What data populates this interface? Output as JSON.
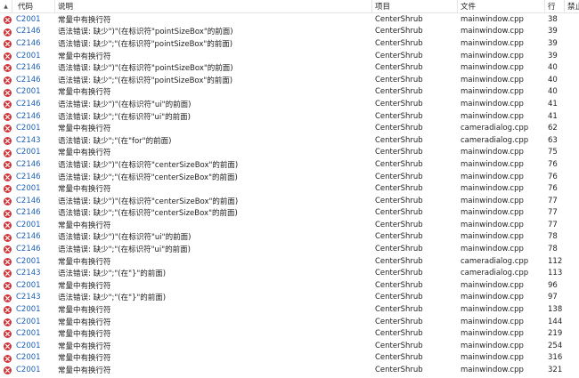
{
  "headers": {
    "code": "代码",
    "description": "说明",
    "project": "项目",
    "file": "文件",
    "line": "行",
    "suppression": "禁止"
  },
  "rows": [
    {
      "code": "C2001",
      "description": "常量中有换行符",
      "project": "CenterShrub",
      "file": "mainwindow.cpp",
      "line": "38"
    },
    {
      "code": "C2146",
      "description": "语法错误: 缺少\")\"(在标识符\"pointSizeBox\"的前面)",
      "project": "CenterShrub",
      "file": "mainwindow.cpp",
      "line": "39"
    },
    {
      "code": "C2146",
      "description": "语法错误: 缺少\";\"(在标识符\"pointSizeBox\"的前面)",
      "project": "CenterShrub",
      "file": "mainwindow.cpp",
      "line": "39"
    },
    {
      "code": "C2001",
      "description": "常量中有换行符",
      "project": "CenterShrub",
      "file": "mainwindow.cpp",
      "line": "39"
    },
    {
      "code": "C2146",
      "description": "语法错误: 缺少\")\"(在标识符\"pointSizeBox\"的前面)",
      "project": "CenterShrub",
      "file": "mainwindow.cpp",
      "line": "40"
    },
    {
      "code": "C2146",
      "description": "语法错误: 缺少\";\"(在标识符\"pointSizeBox\"的前面)",
      "project": "CenterShrub",
      "file": "mainwindow.cpp",
      "line": "40"
    },
    {
      "code": "C2001",
      "description": "常量中有换行符",
      "project": "CenterShrub",
      "file": "mainwindow.cpp",
      "line": "40"
    },
    {
      "code": "C2146",
      "description": "语法错误: 缺少\")\"(在标识符\"ui\"的前面)",
      "project": "CenterShrub",
      "file": "mainwindow.cpp",
      "line": "41"
    },
    {
      "code": "C2146",
      "description": "语法错误: 缺少\";\"(在标识符\"ui\"的前面)",
      "project": "CenterShrub",
      "file": "mainwindow.cpp",
      "line": "41"
    },
    {
      "code": "C2001",
      "description": "常量中有换行符",
      "project": "CenterShrub",
      "file": "cameradialog.cpp",
      "line": "62"
    },
    {
      "code": "C2143",
      "description": "语法错误: 缺少\";\"(在\"for\"的前面)",
      "project": "CenterShrub",
      "file": "cameradialog.cpp",
      "line": "63"
    },
    {
      "code": "C2001",
      "description": "常量中有换行符",
      "project": "CenterShrub",
      "file": "mainwindow.cpp",
      "line": "75"
    },
    {
      "code": "C2146",
      "description": "语法错误: 缺少\")\"(在标识符\"centerSizeBox\"的前面)",
      "project": "CenterShrub",
      "file": "mainwindow.cpp",
      "line": "76"
    },
    {
      "code": "C2146",
      "description": "语法错误: 缺少\";\"(在标识符\"centerSizeBox\"的前面)",
      "project": "CenterShrub",
      "file": "mainwindow.cpp",
      "line": "76"
    },
    {
      "code": "C2001",
      "description": "常量中有换行符",
      "project": "CenterShrub",
      "file": "mainwindow.cpp",
      "line": "76"
    },
    {
      "code": "C2146",
      "description": "语法错误: 缺少\")\"(在标识符\"centerSizeBox\"的前面)",
      "project": "CenterShrub",
      "file": "mainwindow.cpp",
      "line": "77"
    },
    {
      "code": "C2146",
      "description": "语法错误: 缺少\";\"(在标识符\"centerSizeBox\"的前面)",
      "project": "CenterShrub",
      "file": "mainwindow.cpp",
      "line": "77"
    },
    {
      "code": "C2001",
      "description": "常量中有换行符",
      "project": "CenterShrub",
      "file": "mainwindow.cpp",
      "line": "77"
    },
    {
      "code": "C2146",
      "description": "语法错误: 缺少\")\"(在标识符\"ui\"的前面)",
      "project": "CenterShrub",
      "file": "mainwindow.cpp",
      "line": "78"
    },
    {
      "code": "C2146",
      "description": "语法错误: 缺少\";\"(在标识符\"ui\"的前面)",
      "project": "CenterShrub",
      "file": "mainwindow.cpp",
      "line": "78"
    },
    {
      "code": "C2001",
      "description": "常量中有换行符",
      "project": "CenterShrub",
      "file": "cameradialog.cpp",
      "line": "112"
    },
    {
      "code": "C2143",
      "description": "语法错误: 缺少\";\"(在\"}\"的前面)",
      "project": "CenterShrub",
      "file": "cameradialog.cpp",
      "line": "113"
    },
    {
      "code": "C2001",
      "description": "常量中有换行符",
      "project": "CenterShrub",
      "file": "mainwindow.cpp",
      "line": "96"
    },
    {
      "code": "C2143",
      "description": "语法错误: 缺少\";\"(在\"}\"的前面)",
      "project": "CenterShrub",
      "file": "mainwindow.cpp",
      "line": "97"
    },
    {
      "code": "C2001",
      "description": "常量中有换行符",
      "project": "CenterShrub",
      "file": "mainwindow.cpp",
      "line": "138"
    },
    {
      "code": "C2001",
      "description": "常量中有换行符",
      "project": "CenterShrub",
      "file": "mainwindow.cpp",
      "line": "144"
    },
    {
      "code": "C2001",
      "description": "常量中有换行符",
      "project": "CenterShrub",
      "file": "mainwindow.cpp",
      "line": "219"
    },
    {
      "code": "C2001",
      "description": "常量中有换行符",
      "project": "CenterShrub",
      "file": "mainwindow.cpp",
      "line": "254"
    },
    {
      "code": "C2001",
      "description": "常量中有换行符",
      "project": "CenterShrub",
      "file": "mainwindow.cpp",
      "line": "316"
    },
    {
      "code": "C2001",
      "description": "常量中有换行符",
      "project": "CenterShrub",
      "file": "mainwindow.cpp",
      "line": "321"
    }
  ],
  "icons": {
    "row_icon": "error-icon",
    "sort_indicator": "sort-up-icon"
  },
  "colors": {
    "error": "#d13438",
    "code_link": "#1a5fb4"
  }
}
